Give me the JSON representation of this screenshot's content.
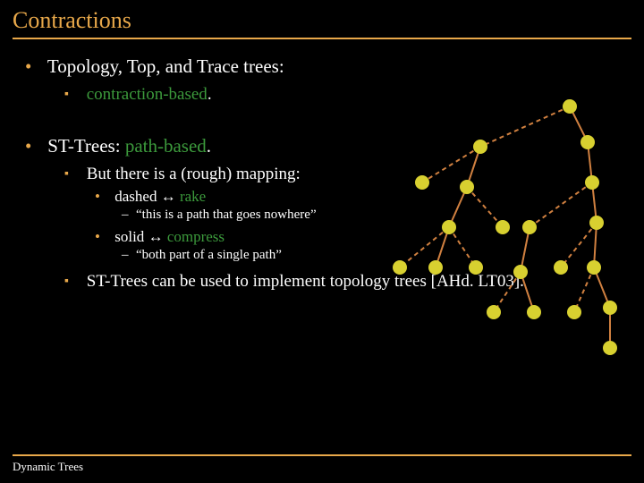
{
  "title": "Contractions",
  "bullets": {
    "b1": "Topology, Top, and Trace trees:",
    "b1a": "contraction-based",
    "b1a_suffix": ".",
    "b2_pre": "ST-Trees: ",
    "b2_green": "path-based",
    "b2_suffix": ".",
    "b2a": "But there is a (rough) mapping:",
    "b2a_i_pre": "dashed ",
    "b2a_i_arrow": "↔",
    "b2a_i_green": " rake",
    "b2a_i_sub": "“this is a path that goes nowhere”",
    "b2a_ii_pre": "solid ",
    "b2a_ii_arrow": "↔",
    "b2a_ii_green": " compress",
    "b2a_ii_sub": "“both part of a single path”",
    "b2b": "ST-Trees can be used to implement topology trees [AHd. LT03]."
  },
  "footer": "Dynamic Trees",
  "colors": {
    "accent": "#e8a84a",
    "green": "#3c9a3c",
    "node": "#d8d030",
    "edge": "#d08040"
  }
}
